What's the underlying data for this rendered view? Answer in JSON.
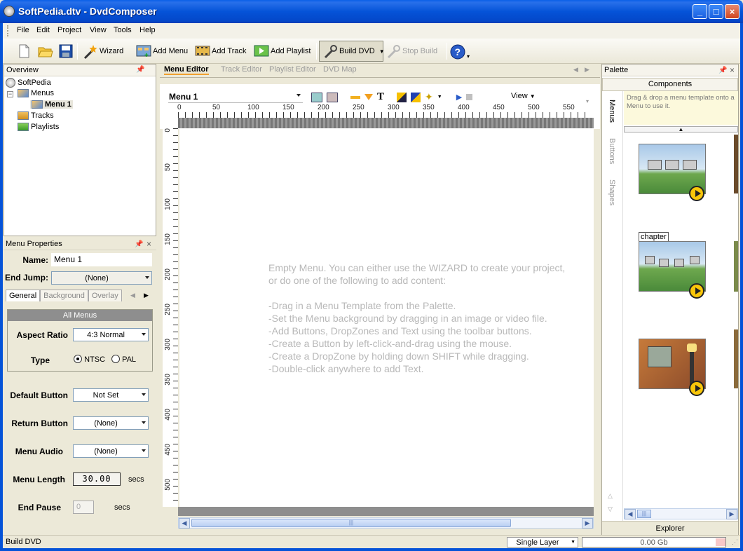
{
  "window": {
    "title": "SoftPedia.dtv - DvdComposer",
    "min": "_",
    "max": "□",
    "close": "×"
  },
  "menu": [
    "File",
    "Edit",
    "Project",
    "View",
    "Tools",
    "Help"
  ],
  "toolbar": {
    "wizard": "Wizard",
    "add_menu": "Add Menu",
    "add_track": "Add Track",
    "add_playlist": "Add Playlist",
    "build_dvd": "Build DVD",
    "stop_build": "Stop Build"
  },
  "overview": {
    "title": "Overview",
    "tree": {
      "root": "SoftPedia",
      "menus": "Menus",
      "menu1": "Menu 1",
      "tracks": "Tracks",
      "playlists": "Playlists"
    }
  },
  "props": {
    "title": "Menu Properties",
    "name_label": "Name:",
    "name_value": "Menu 1",
    "end_jump_label": "End Jump:",
    "end_jump_value": "(None)",
    "tabs": [
      "General",
      "Background",
      "Overlay"
    ],
    "group_title": "All Menus",
    "aspect_label": "Aspect Ratio",
    "aspect_value": "4:3 Normal",
    "type_label": "Type",
    "ntsc": "NTSC",
    "pal": "PAL",
    "default_button_label": "Default Button",
    "default_button_value": "Not Set",
    "return_button_label": "Return Button",
    "return_button_value": "(None)",
    "menu_audio_label": "Menu Audio",
    "menu_audio_value": "(None)",
    "menu_length_label": "Menu Length",
    "menu_length_value": "30.00",
    "secs": "secs",
    "end_pause_label": "End Pause",
    "end_pause_value": "0"
  },
  "editor": {
    "tabs": [
      "Menu Editor",
      "Track Editor",
      "Playlist Editor",
      "DVD Map"
    ],
    "menu_select": "Menu 1",
    "view": "View",
    "hruler": [
      "0",
      "50",
      "100",
      "150",
      "200",
      "250",
      "300",
      "350",
      "400",
      "450",
      "500",
      "550"
    ],
    "vruler": [
      "0",
      "50",
      "100",
      "150",
      "200",
      "250",
      "300",
      "350",
      "400",
      "450",
      "500"
    ],
    "message": [
      "Empty Menu. You can either use the WIZARD to create your project,",
      "or do one of the following to add content:",
      "",
      "-Drag in a Menu Template from the Palette.",
      "-Set the Menu background by dragging in an image or video file.",
      "-Add Buttons, DropZones and Text using the toolbar buttons.",
      "-Create a Button by left-click-and-drag using the mouse.",
      "-Create a DropZone by holding down SHIFT while dragging.",
      "-Double-click anywhere to add Text."
    ]
  },
  "palette": {
    "title": "Palette",
    "components": "Components",
    "hint": "Drag & drop a menu template onto a Menu to use it.",
    "vtabs": [
      "Menus",
      "Buttons",
      "Shapes"
    ],
    "chapter_label": "chapter",
    "explorer": "Explorer"
  },
  "status": {
    "text": "Build DVD",
    "layer": "Single Layer",
    "size": "0.00 Gb"
  }
}
